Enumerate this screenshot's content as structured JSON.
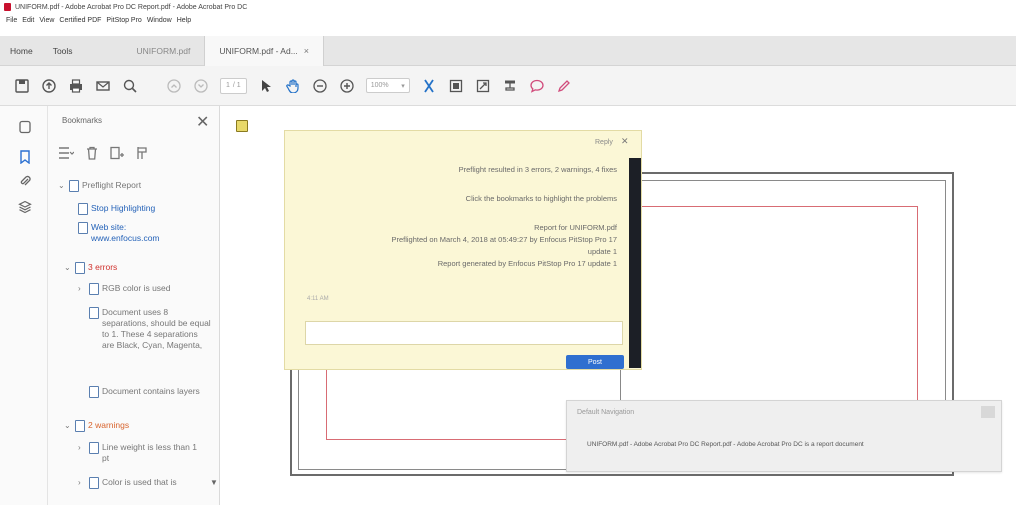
{
  "window": {
    "title": "UNIFORM.pdf - Adobe Acrobat Pro DC Report.pdf - Adobe Acrobat Pro DC"
  },
  "menu": [
    "File",
    "Edit",
    "View",
    "Certified PDF",
    "PitStop Pro",
    "Window",
    "Help"
  ],
  "nav_tabs": [
    "Home",
    "Tools"
  ],
  "doc_tabs": [
    {
      "label": "UNIFORM.pdf",
      "active": false
    },
    {
      "label": "UNIFORM.pdf - Ad...",
      "active": true,
      "close": "×"
    }
  ],
  "toolbar": {
    "page_current": "1",
    "page_total": "/ 1",
    "zoom": "100%",
    "zoom_arrow": "▾",
    "icons": [
      "save-icon",
      "upload-icon",
      "print-icon",
      "email-icon",
      "search-icon",
      "page-up-icon",
      "page-down-icon",
      "select-cursor-icon",
      "hand-icon",
      "zoom-out-icon",
      "zoom-in-icon",
      "crop-icon",
      "page-fit-icon",
      "page-fit-alt-icon",
      "stamp-icon",
      "comment-icon",
      "pen-icon"
    ]
  },
  "sidebar": {
    "title": "Bookmarks",
    "close": "✕",
    "bookmarks": [
      {
        "label": "Preflight Report",
        "style": "gray",
        "chevron": "⌄"
      },
      {
        "label": "Stop Highlighting",
        "style": "link"
      },
      {
        "label": "Web site: www.enfocus.com",
        "style": "link"
      },
      {
        "label": "3 errors",
        "style": "red",
        "chevron": "⌄"
      },
      {
        "label": "RGB color is used",
        "style": "gray",
        "chevron": "›"
      },
      {
        "label": "Document uses 8 separations, should be equal to 1. These 4 separations are Black, Cyan, Magenta,",
        "style": "gray"
      },
      {
        "label": "Document contains layers",
        "style": "gray"
      },
      {
        "label": "2 warnings",
        "style": "orange",
        "chevron": "⌄"
      },
      {
        "label": "Line weight is less than 1 pt",
        "style": "gray",
        "chevron": "›"
      },
      {
        "label": "Color is used that is",
        "style": "gray",
        "chevron": "›"
      }
    ]
  },
  "comment": {
    "reply": "Reply",
    "close": "✕",
    "lines": [
      "Preflight resulted in 3 errors, 2 warnings, 4 fixes",
      "Click the bookmarks to highlight the problems",
      "Report for UNIFORM.pdf",
      "Preflighted on March 4, 2018 at 05:49:27 by Enfocus PitStop Pro 17",
      "update 1",
      "Report generated by Enfocus PitStop Pro 17 update 1"
    ],
    "time": "4:11 AM",
    "post_label": "Post"
  },
  "notification": {
    "title": "Default Navigation",
    "message": "UNIFORM.pdf - Adobe Acrobat Pro DC Report.pdf - Adobe Acrobat Pro DC is a report document"
  },
  "colors": {
    "accent": "#2f6fd0",
    "error": "#d0312d",
    "warning": "#d8632c",
    "note_bg": "#fbf7d6"
  }
}
